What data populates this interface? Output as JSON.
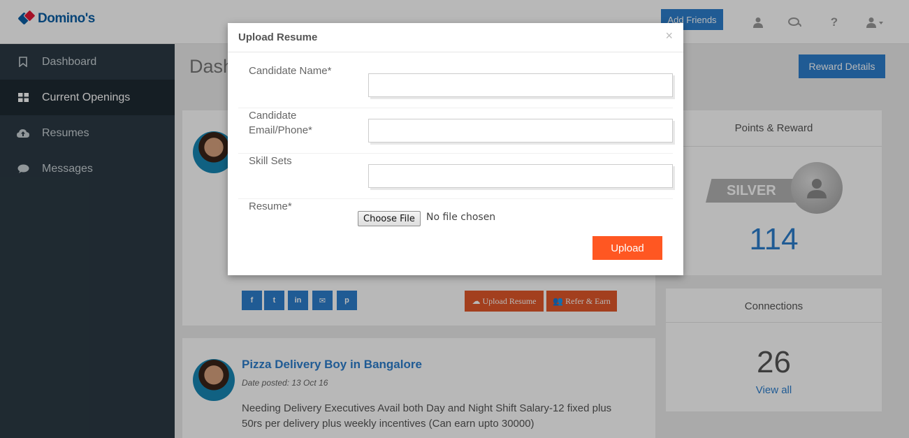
{
  "header": {
    "logo_text": "Domino's",
    "add_friends_label": "Add Friends",
    "icons": [
      "user-icon",
      "chat-icon",
      "help-icon",
      "account-menu-icon"
    ]
  },
  "sidebar": {
    "items": [
      {
        "label": "Dashboard",
        "icon": "bookmark-icon",
        "active": false
      },
      {
        "label": "Current Openings",
        "icon": "grid-icon",
        "active": true
      },
      {
        "label": "Resumes",
        "icon": "cloud-upload-icon",
        "active": false
      },
      {
        "label": "Messages",
        "icon": "chat-bubble-icon",
        "active": false
      }
    ]
  },
  "main": {
    "page_title": "Dash",
    "reward_details_label": "Reward Details",
    "post1": {
      "upload_resume_label": "Upload Resume",
      "refer_earn_label": "Refer & Earn",
      "social": [
        "f",
        "t",
        "in",
        "✉",
        "p"
      ]
    },
    "post2": {
      "title": "Pizza Delivery Boy in Bangalore",
      "date": "Date posted: 13 Oct 16",
      "description": "Needing Delivery Executives Avail both Day and Night Shift Salary-12 fixed plus 50rs per delivery plus weekly incentives (Can earn upto 30000)"
    }
  },
  "rewards": {
    "title": "Points & Reward",
    "tier": "SILVER",
    "points": "114"
  },
  "connections": {
    "title": "Connections",
    "count": "26",
    "view_all_label": "View all"
  },
  "modal": {
    "title": "Upload Resume",
    "close_label": "×",
    "fields": {
      "name_label": "Candidate Name*",
      "contact_label_line1": "Candidate",
      "contact_label_line2": "Email/Phone*",
      "skills_label": "Skill Sets",
      "resume_label": "Resume*"
    },
    "file_button_label": "Choose File",
    "file_status": "No file chosen",
    "upload_label": "Upload"
  },
  "colors": {
    "primary": "#2d7fce",
    "accent": "#ff5722",
    "sidebar": "#2b3a44"
  }
}
